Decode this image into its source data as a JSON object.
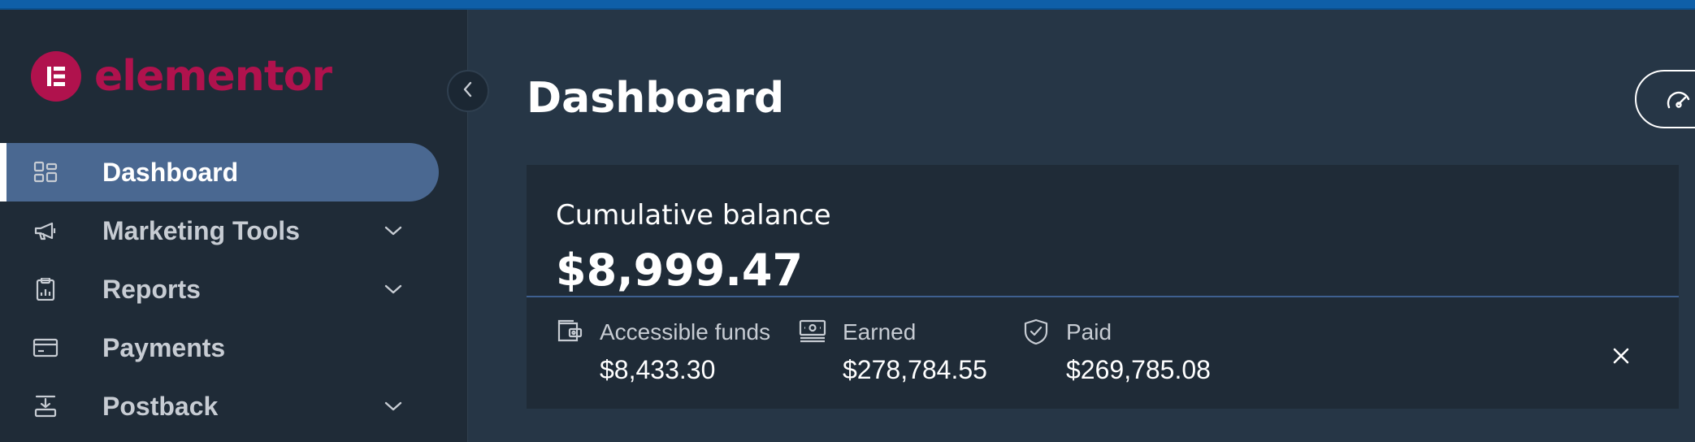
{
  "brand": {
    "name": "elementor",
    "color": "#b0124d"
  },
  "sidebar": {
    "items": [
      {
        "label": "Dashboard",
        "icon": "dashboard-grid-icon",
        "active": true
      },
      {
        "label": "Marketing Tools",
        "icon": "megaphone-icon",
        "has_submenu": true
      },
      {
        "label": "Reports",
        "icon": "clipboard-icon",
        "has_submenu": true
      },
      {
        "label": "Payments",
        "icon": "credit-card-icon"
      },
      {
        "label": "Postback",
        "icon": "postback-icon",
        "has_submenu": true
      }
    ],
    "active_color": "#4a6891"
  },
  "header": {
    "title": "Dashboard",
    "right_button_icon": "speedometer-icon"
  },
  "balance_card": {
    "title": "Cumulative balance",
    "value": "$8,999.47",
    "stats": [
      {
        "label": "Accessible funds",
        "value": "$8,433.30",
        "icon": "wallet-icon"
      },
      {
        "label": "Earned",
        "value": "$278,784.55",
        "icon": "cash-icon"
      },
      {
        "label": "Paid",
        "value": "$269,785.08",
        "icon": "shield-check-icon"
      }
    ],
    "close_icon": "close-icon"
  },
  "colors": {
    "background": "#263646",
    "sidebar": "#1f2b37",
    "card": "#1f2b37",
    "topbar": "#0f5fa8"
  }
}
